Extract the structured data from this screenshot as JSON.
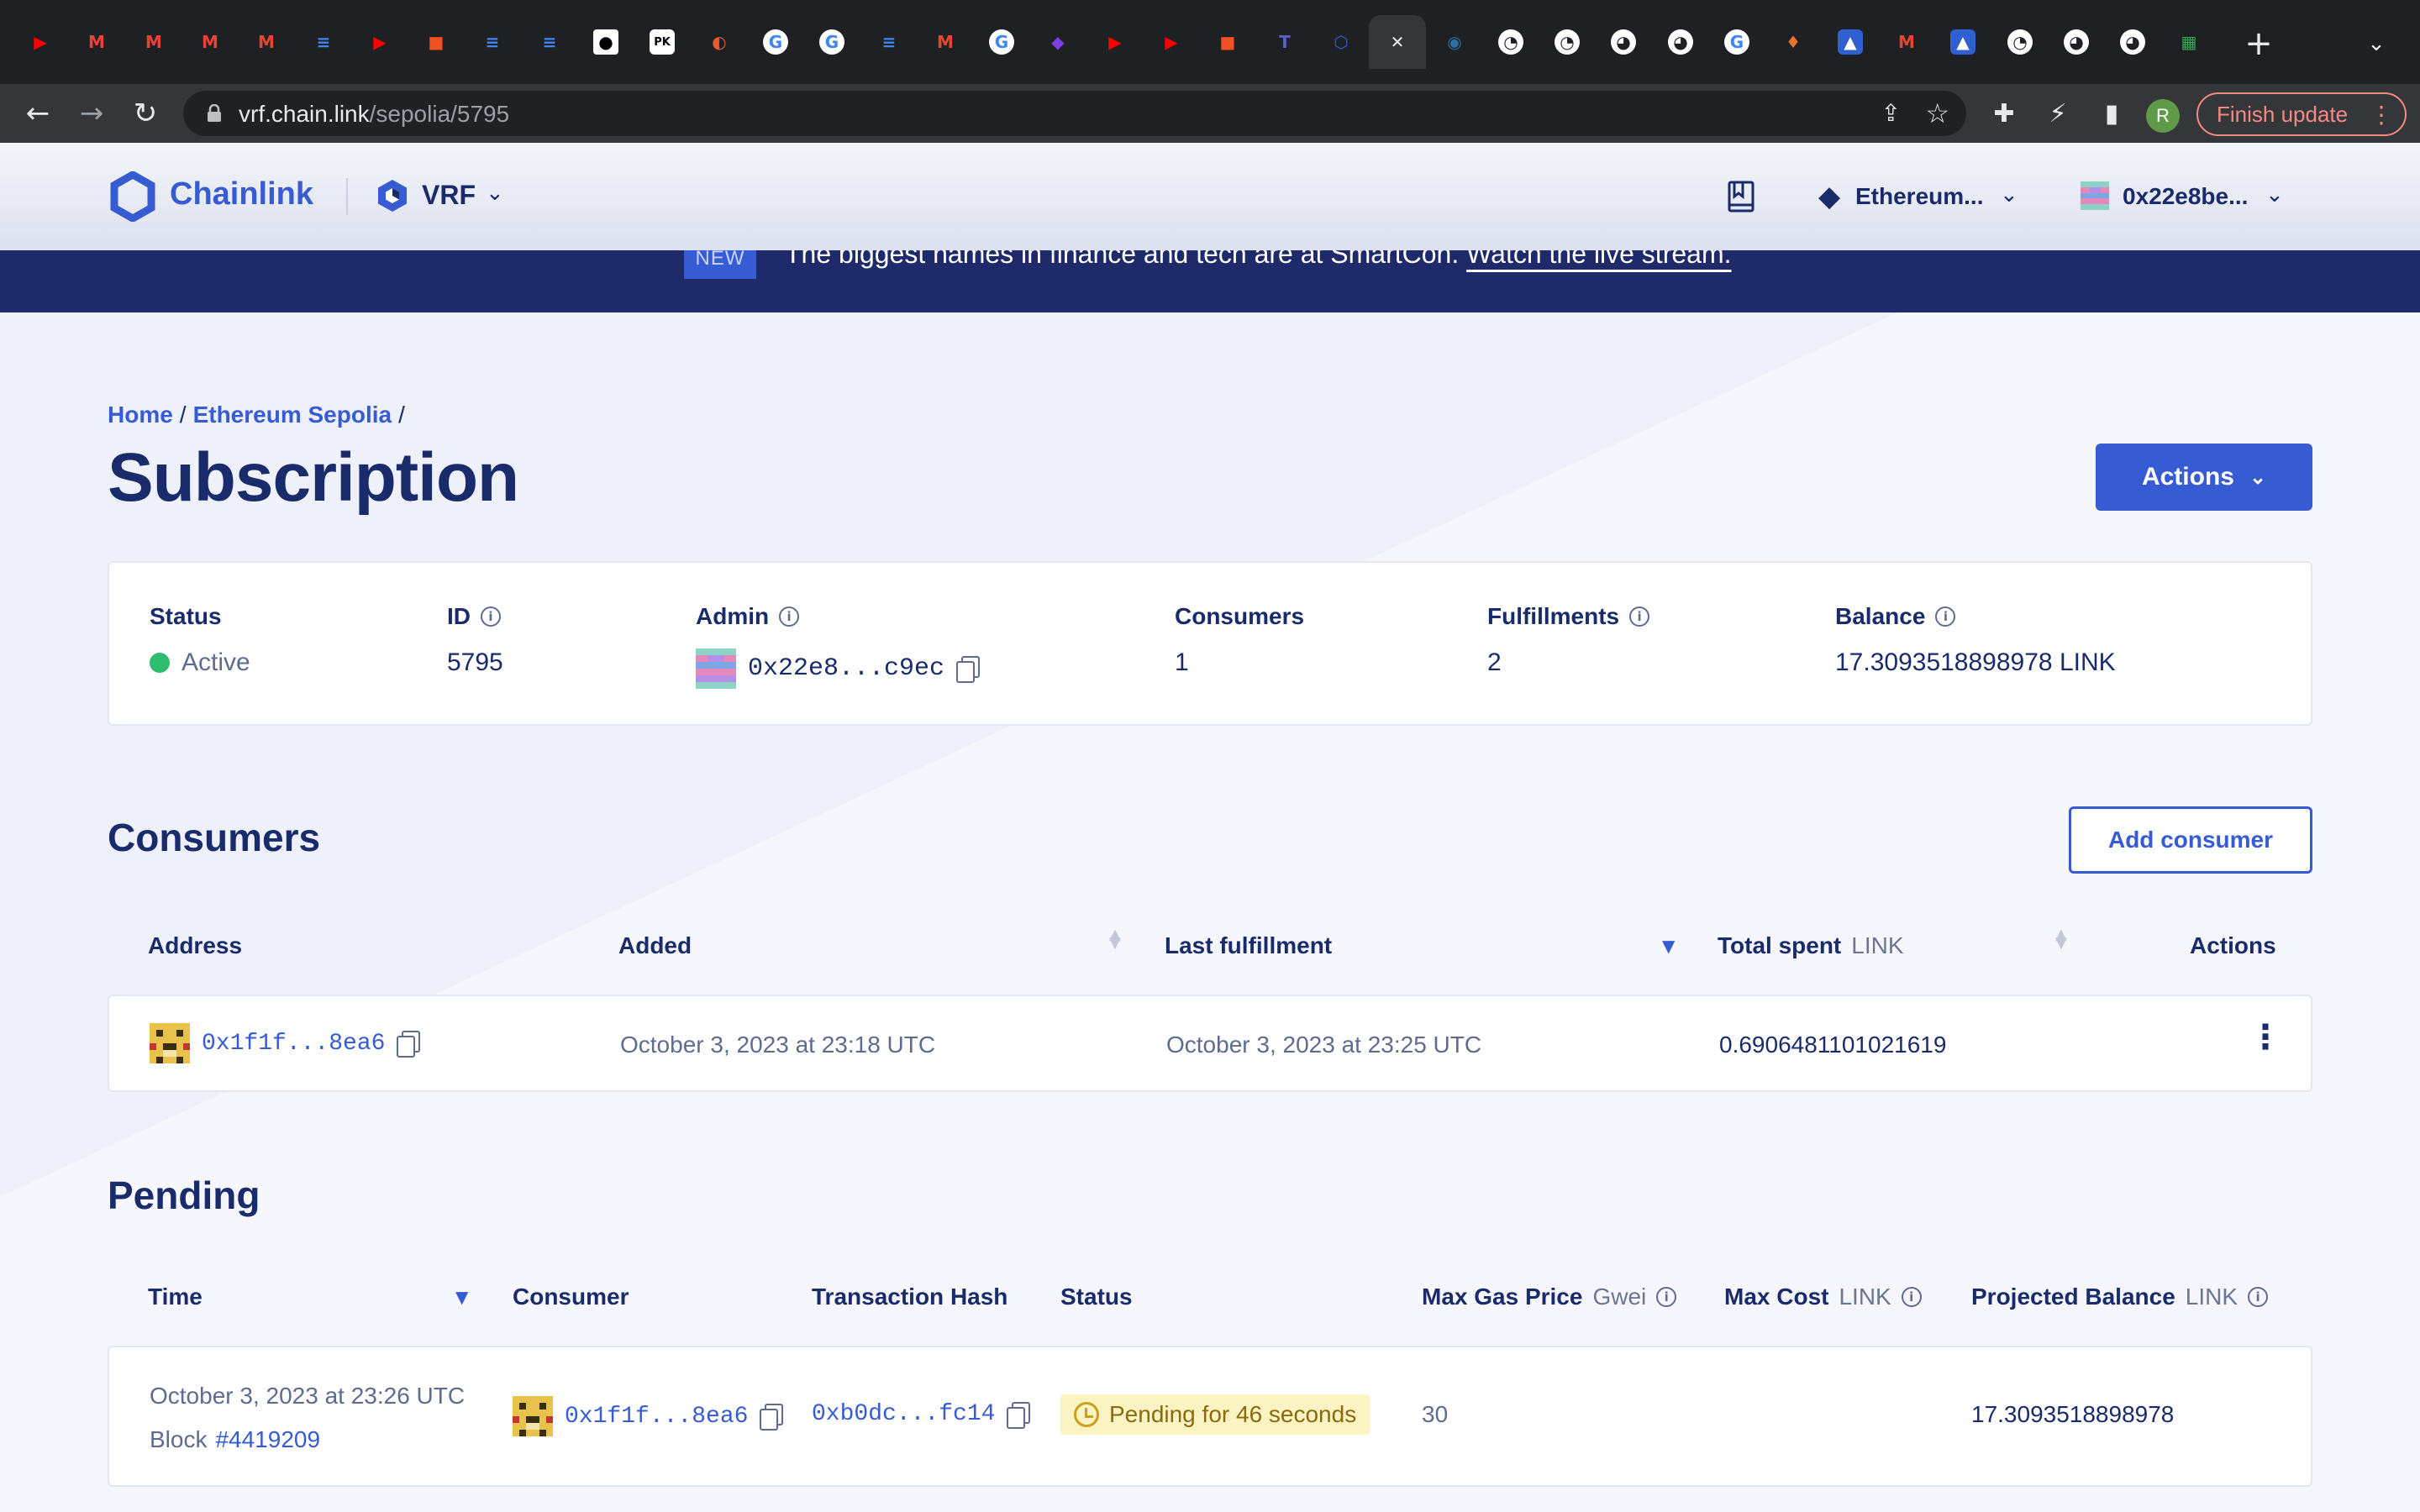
{
  "browser": {
    "tabs": [
      {
        "icon": "youtube-icon",
        "glyph": "▶",
        "color": "#ff0000"
      },
      {
        "icon": "gmail-icon",
        "glyph": "M",
        "color": "#ea4335"
      },
      {
        "icon": "gmail-icon",
        "glyph": "M",
        "color": "#ea4335"
      },
      {
        "icon": "gmail-icon",
        "glyph": "M",
        "color": "#ea4335"
      },
      {
        "icon": "gmail-icon",
        "glyph": "M",
        "color": "#ea4335"
      },
      {
        "icon": "google-docs-icon",
        "glyph": "≡",
        "color": "#4285f4"
      },
      {
        "icon": "youtube-icon",
        "glyph": "▶",
        "color": "#ff0000"
      },
      {
        "icon": "microsoft-icon",
        "glyph": "■",
        "color": "#f25022"
      },
      {
        "icon": "google-docs-icon",
        "glyph": "≡",
        "color": "#4285f4"
      },
      {
        "icon": "google-docs-icon",
        "glyph": "≡",
        "color": "#4285f4"
      },
      {
        "icon": "medium-icon",
        "glyph": "●",
        "color": "#000000"
      },
      {
        "icon": "pk-icon",
        "glyph": "PK",
        "color": "#ffffff"
      },
      {
        "icon": "orange-icon",
        "glyph": "◐",
        "color": "#e65c2b"
      },
      {
        "icon": "google-icon",
        "glyph": "G",
        "color": "#ffffff"
      },
      {
        "icon": "google-icon",
        "glyph": "G",
        "color": "#ffffff"
      },
      {
        "icon": "google-docs-icon",
        "glyph": "≡",
        "color": "#4285f4"
      },
      {
        "icon": "gmail-icon",
        "glyph": "M",
        "color": "#ea4335"
      },
      {
        "icon": "google-icon",
        "glyph": "G",
        "color": "#ffffff"
      },
      {
        "icon": "shield-icon",
        "glyph": "◆",
        "color": "#7b3fe4"
      },
      {
        "icon": "youtube-icon",
        "glyph": "▶",
        "color": "#ff0000"
      },
      {
        "icon": "youtube-icon",
        "glyph": "▶",
        "color": "#ff0000"
      },
      {
        "icon": "microsoft-icon",
        "glyph": "■",
        "color": "#f25022"
      },
      {
        "icon": "teams-icon",
        "glyph": "T",
        "color": "#5b5fc7"
      },
      {
        "icon": "chainlink-icon",
        "glyph": "⬡",
        "color": "#375bd2"
      },
      {
        "icon": "close-icon",
        "glyph": "✕",
        "color": "#e8eaed"
      },
      {
        "icon": "globe-icon",
        "glyph": "◉",
        "color": "#2b6fa6"
      },
      {
        "icon": "chart-icon",
        "glyph": "◔",
        "color": "#ffffff"
      },
      {
        "icon": "chart-icon",
        "glyph": "◔",
        "color": "#ffffff"
      },
      {
        "icon": "github-icon",
        "glyph": "◕",
        "color": "#ffffff"
      },
      {
        "icon": "github-icon",
        "glyph": "◕",
        "color": "#ffffff"
      },
      {
        "icon": "google-icon",
        "glyph": "G",
        "color": "#ffffff"
      },
      {
        "icon": "drop-icon",
        "glyph": "♦",
        "color": "#e8742b"
      },
      {
        "icon": "triangle-icon",
        "glyph": "▲",
        "color": "#ffffff"
      },
      {
        "icon": "gmail-icon",
        "glyph": "M",
        "color": "#ea4335"
      },
      {
        "icon": "triangle-icon",
        "glyph": "▲",
        "color": "#ffffff"
      },
      {
        "icon": "chart-icon",
        "glyph": "◔",
        "color": "#ffffff"
      },
      {
        "icon": "github-icon",
        "glyph": "◕",
        "color": "#ffffff"
      },
      {
        "icon": "github-icon",
        "glyph": "◕",
        "color": "#ffffff"
      },
      {
        "icon": "sheets-icon",
        "glyph": "▦",
        "color": "#34a853"
      }
    ],
    "url_host": "vrf.chain.link",
    "url_path": "/sepolia/5795",
    "profile_initial": "R",
    "finish_update": "Finish update"
  },
  "header": {
    "brand": "Chainlink",
    "product": "VRF",
    "network": "Ethereum...",
    "wallet": "0x22e8be..."
  },
  "banner": {
    "badge": "NEW",
    "text": "The biggest names in finance and tech are at SmartCon. ",
    "link": "Watch the live stream."
  },
  "breadcrumb": {
    "home": "Home",
    "network": "Ethereum Sepolia"
  },
  "page": {
    "title": "Subscription",
    "actions_label": "Actions"
  },
  "summary": {
    "status_label": "Status",
    "status_value": "Active",
    "id_label": "ID",
    "id_value": "5795",
    "admin_label": "Admin",
    "admin_value": "0x22e8...c9ec",
    "consumers_label": "Consumers",
    "consumers_value": "1",
    "fulfillments_label": "Fulfillments",
    "fulfillments_value": "2",
    "balance_label": "Balance",
    "balance_value": "17.3093518898978 LINK"
  },
  "consumers": {
    "title": "Consumers",
    "add_label": "Add consumer",
    "headers": {
      "address": "Address",
      "added": "Added",
      "last_fulfillment": "Last fulfillment",
      "total_spent": "Total spent",
      "total_spent_unit": "LINK",
      "actions": "Actions"
    },
    "rows": [
      {
        "address": "0x1f1f...8ea6",
        "added": "October 3, 2023 at 23:18 UTC",
        "last_fulfillment": "October 3, 2023 at 23:25 UTC",
        "total_spent": "0.6906481101021619"
      }
    ]
  },
  "pending": {
    "title": "Pending",
    "headers": {
      "time": "Time",
      "consumer": "Consumer",
      "tx_hash": "Transaction Hash",
      "status": "Status",
      "max_gas": "Max Gas Price",
      "max_gas_unit": "Gwei",
      "max_cost": "Max Cost",
      "max_cost_unit": "LINK",
      "projected": "Projected Balance",
      "projected_unit": "LINK"
    },
    "rows": [
      {
        "time": "October 3, 2023 at 23:26 UTC",
        "block_label": "Block",
        "block": "#4419209",
        "consumer": "0x1f1f...8ea6",
        "tx_hash": "0xb0dc...fc14",
        "status": "Pending for 46 seconds",
        "max_gas": "30",
        "max_cost": "",
        "projected": "17.3093518898978"
      }
    ]
  },
  "colors": {
    "accent": "#375bd2",
    "navy": "#1a2b6b",
    "banner": "#1e2a6a",
    "active_status": "#2dbd6e",
    "pending_badge": "#fcf3c3"
  }
}
